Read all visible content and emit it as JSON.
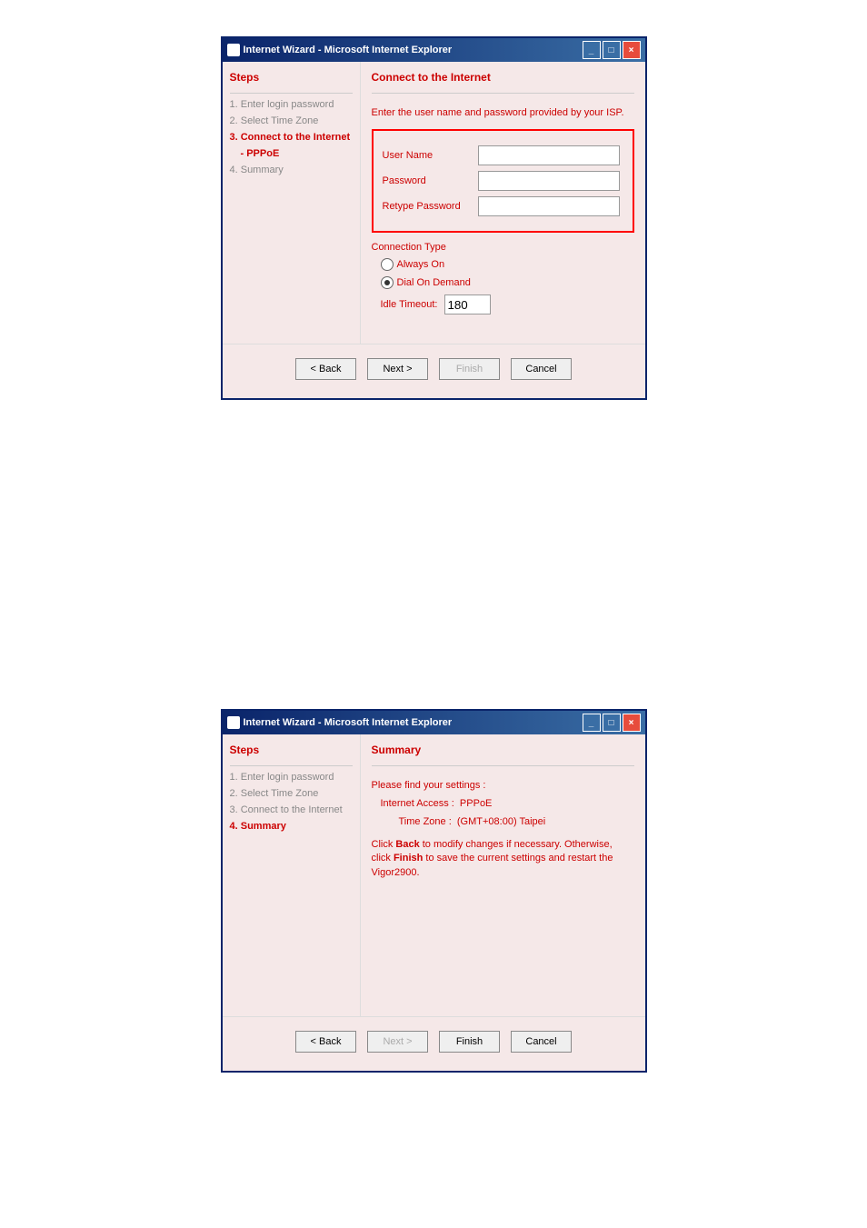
{
  "win1": {
    "title": "Internet Wizard - Microsoft Internet Explorer",
    "sidebar_title": "Steps",
    "steps": {
      "s1": "1. Enter login password",
      "s2": "2. Select Time Zone",
      "s3": "3. Connect to the Internet",
      "s3sub": "- PPPoE",
      "s4": "4. Summary"
    },
    "main_title": "Connect to the Internet",
    "instruction": "Enter the user name and password provided by your ISP.",
    "labels": {
      "username": "User Name",
      "password": "Password",
      "retype": "Retype Password",
      "conn_type": "Connection Type",
      "always_on": "Always On",
      "dial_on_demand": "Dial On Demand",
      "idle_timeout": "Idle Timeout:"
    },
    "idle_value": "180",
    "buttons": {
      "back": "< Back",
      "next": "Next >",
      "finish": "Finish",
      "cancel": "Cancel"
    }
  },
  "win2": {
    "title": "Internet Wizard - Microsoft Internet Explorer",
    "sidebar_title": "Steps",
    "steps": {
      "s1": "1. Enter login password",
      "s2": "2. Select Time Zone",
      "s3": "3. Connect to the Internet",
      "s4": "4. Summary"
    },
    "main_title": "Summary",
    "find_settings": "Please find your settings :",
    "internet_access": "Internet Access :  PPPoE",
    "time_zone": "Time Zone :  (GMT+08:00) Taipei",
    "note_pre": "Click ",
    "note_back": "Back",
    "note_mid": " to modify changes if necessary. Otherwise, click ",
    "note_finish": "Finish",
    "note_post": " to save the current settings and restart the Vigor2900.",
    "buttons": {
      "back": "< Back",
      "next": "Next >",
      "finish": "Finish",
      "cancel": "Cancel"
    }
  }
}
